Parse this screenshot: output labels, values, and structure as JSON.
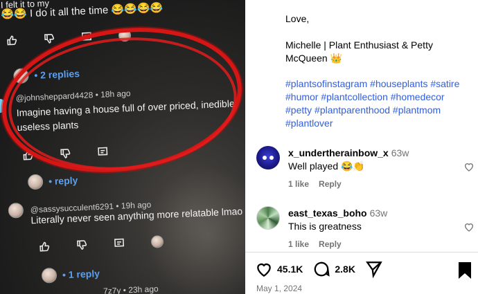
{
  "photo": {
    "top_comment_fragment": "I felt it to my",
    "top_comment_line": "😂😂 I do it all the time 😂😂😂😂",
    "replies_1": "• 2 replies",
    "circled": {
      "handle": "@johnsheppard4428 • 18h ago",
      "line1": "Imagine having a house full of over priced, inedible,",
      "line2": "useless plants"
    },
    "reply_link_partial": "• reply",
    "comment2": {
      "handle": "@sassysucculent6291 • 19h ago",
      "text": "Literally never seen anything more relatable lmao"
    },
    "replies_2": "• 1 reply",
    "bottom_handle_partial": "7z7y • 23h ago",
    "highlight_color": "#d61515",
    "link_color": "#5a9ff0"
  },
  "caption": {
    "signoff": "Love,",
    "signature_line1": "Michelle | Plant Enthusiast & Petty",
    "signature_line2": "McQueen 👑",
    "hashtags_line1": "#plantsofinstagram #houseplants #satire",
    "hashtags_line2": "#humor #plantcollection #homedecor",
    "hashtags_line3": "#petty #plantparenthood #plantmom",
    "hashtags_line4": "#plantlover",
    "hashtag_color": "#2f5ee0"
  },
  "comments": [
    {
      "username": "x_undertherainbow_x",
      "time": "63w",
      "text": "Well played 😂👏",
      "likes": "1 like",
      "reply_label": "Reply",
      "avatar_icon": "blue-creature-avatar"
    },
    {
      "username": "east_texas_boho",
      "time": "63w",
      "text": "This is greatness",
      "likes": "1 like",
      "reply_label": "Reply",
      "avatar_icon": "plant-leaves-avatar"
    }
  ],
  "actions": {
    "like_count": "45.1K",
    "comment_count": "2.8K",
    "icons": [
      "heart-icon",
      "comment-bubble-icon",
      "share-send-icon",
      "bookmark-icon"
    ]
  },
  "post_date": "May 1, 2024"
}
